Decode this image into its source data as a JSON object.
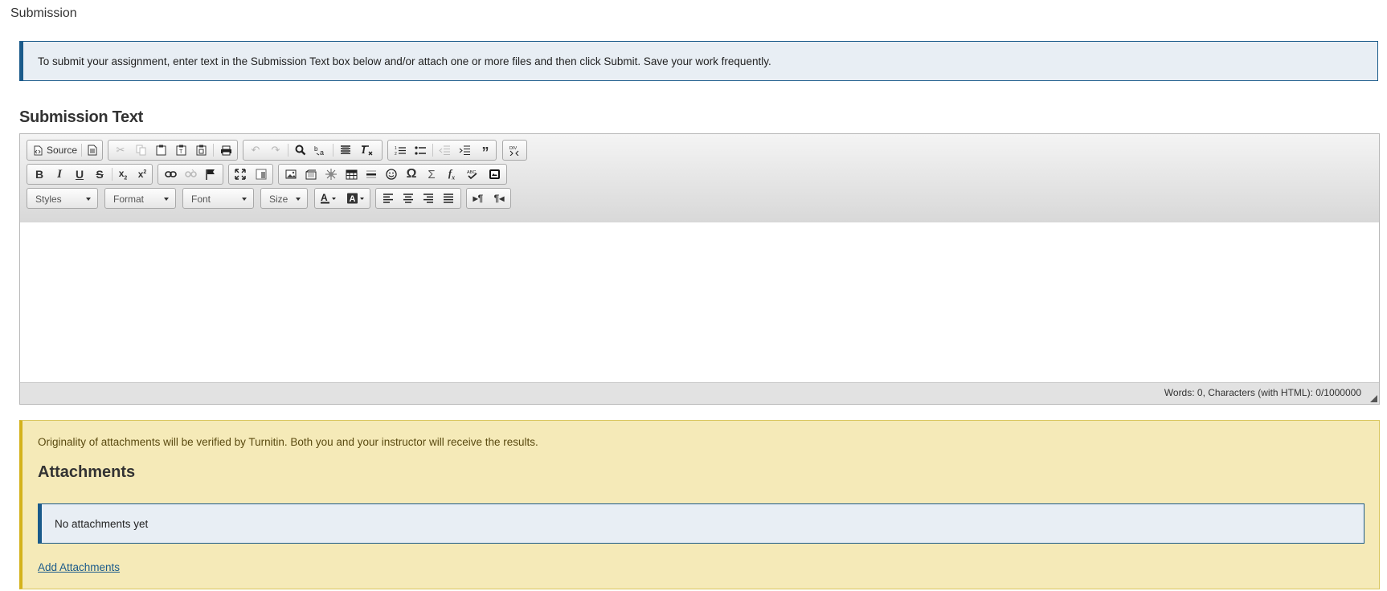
{
  "section_title": "Submission",
  "info_message": "To submit your assignment, enter text in the Submission Text box below and/or attach one or more files and then click Submit. Save your work frequently.",
  "submission_text_heading": "Submission Text",
  "editor": {
    "source_label": "Source",
    "combos": {
      "styles": "Styles",
      "format": "Format",
      "font": "Font",
      "size": "Size"
    },
    "status": "Words: 0, Characters (with HTML): 0/1000000"
  },
  "turnitin_notice": "Originality of attachments will be verified by Turnitin. Both you and your instructor will receive the results.",
  "attachments_heading": "Attachments",
  "no_attachments": "No attachments yet",
  "add_attachments_label": "Add Attachments",
  "colors": {
    "info_border": "#1a5a8a",
    "info_bg": "#e8eef4",
    "notice_bg": "#f5eab8",
    "notice_border": "#d4b21b",
    "link": "#1a5a8a"
  }
}
